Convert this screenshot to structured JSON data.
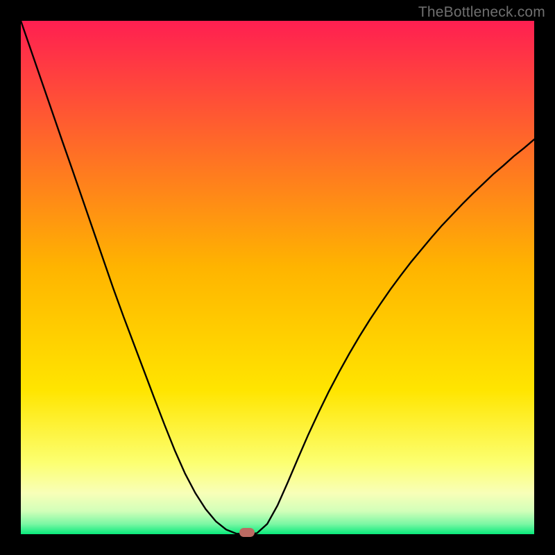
{
  "watermark": "TheBottleneck.com",
  "colors": {
    "frame": "#000000",
    "top": "#ff1f51",
    "mid": "#ffd300",
    "lowblend1": "#fff85a",
    "lowblend2": "#fcffa5",
    "softBand": "#d9ffb0",
    "bottom": "#08ea7b",
    "curve": "#000000",
    "marker": "#bb6a62"
  },
  "chart_data": {
    "type": "line",
    "title": "",
    "xlabel": "",
    "ylabel": "",
    "x": [
      0.0,
      0.02,
      0.04,
      0.06,
      0.08,
      0.1,
      0.12,
      0.14,
      0.16,
      0.18,
      0.2,
      0.22,
      0.24,
      0.26,
      0.28,
      0.3,
      0.32,
      0.34,
      0.36,
      0.38,
      0.4,
      0.42,
      0.44,
      0.46,
      0.48,
      0.5,
      0.52,
      0.54,
      0.56,
      0.58,
      0.6,
      0.62,
      0.64,
      0.66,
      0.68,
      0.7,
      0.72,
      0.74,
      0.76,
      0.78,
      0.8,
      0.82,
      0.84,
      0.86,
      0.88,
      0.9,
      0.92,
      0.94,
      0.96,
      0.98,
      1.0
    ],
    "values": [
      1.0,
      0.942,
      0.884,
      0.826,
      0.768,
      0.711,
      0.653,
      0.595,
      0.537,
      0.479,
      0.424,
      0.371,
      0.318,
      0.265,
      0.213,
      0.163,
      0.118,
      0.08,
      0.049,
      0.025,
      0.009,
      0.001,
      0.0,
      0.002,
      0.02,
      0.056,
      0.101,
      0.148,
      0.194,
      0.237,
      0.278,
      0.316,
      0.352,
      0.386,
      0.418,
      0.448,
      0.477,
      0.504,
      0.53,
      0.554,
      0.578,
      0.601,
      0.622,
      0.643,
      0.663,
      0.682,
      0.701,
      0.718,
      0.736,
      0.752,
      0.769
    ],
    "xlim": [
      0,
      1
    ],
    "ylim": [
      0,
      1
    ],
    "marker_x": 0.44,
    "marker_y": 0.0
  }
}
